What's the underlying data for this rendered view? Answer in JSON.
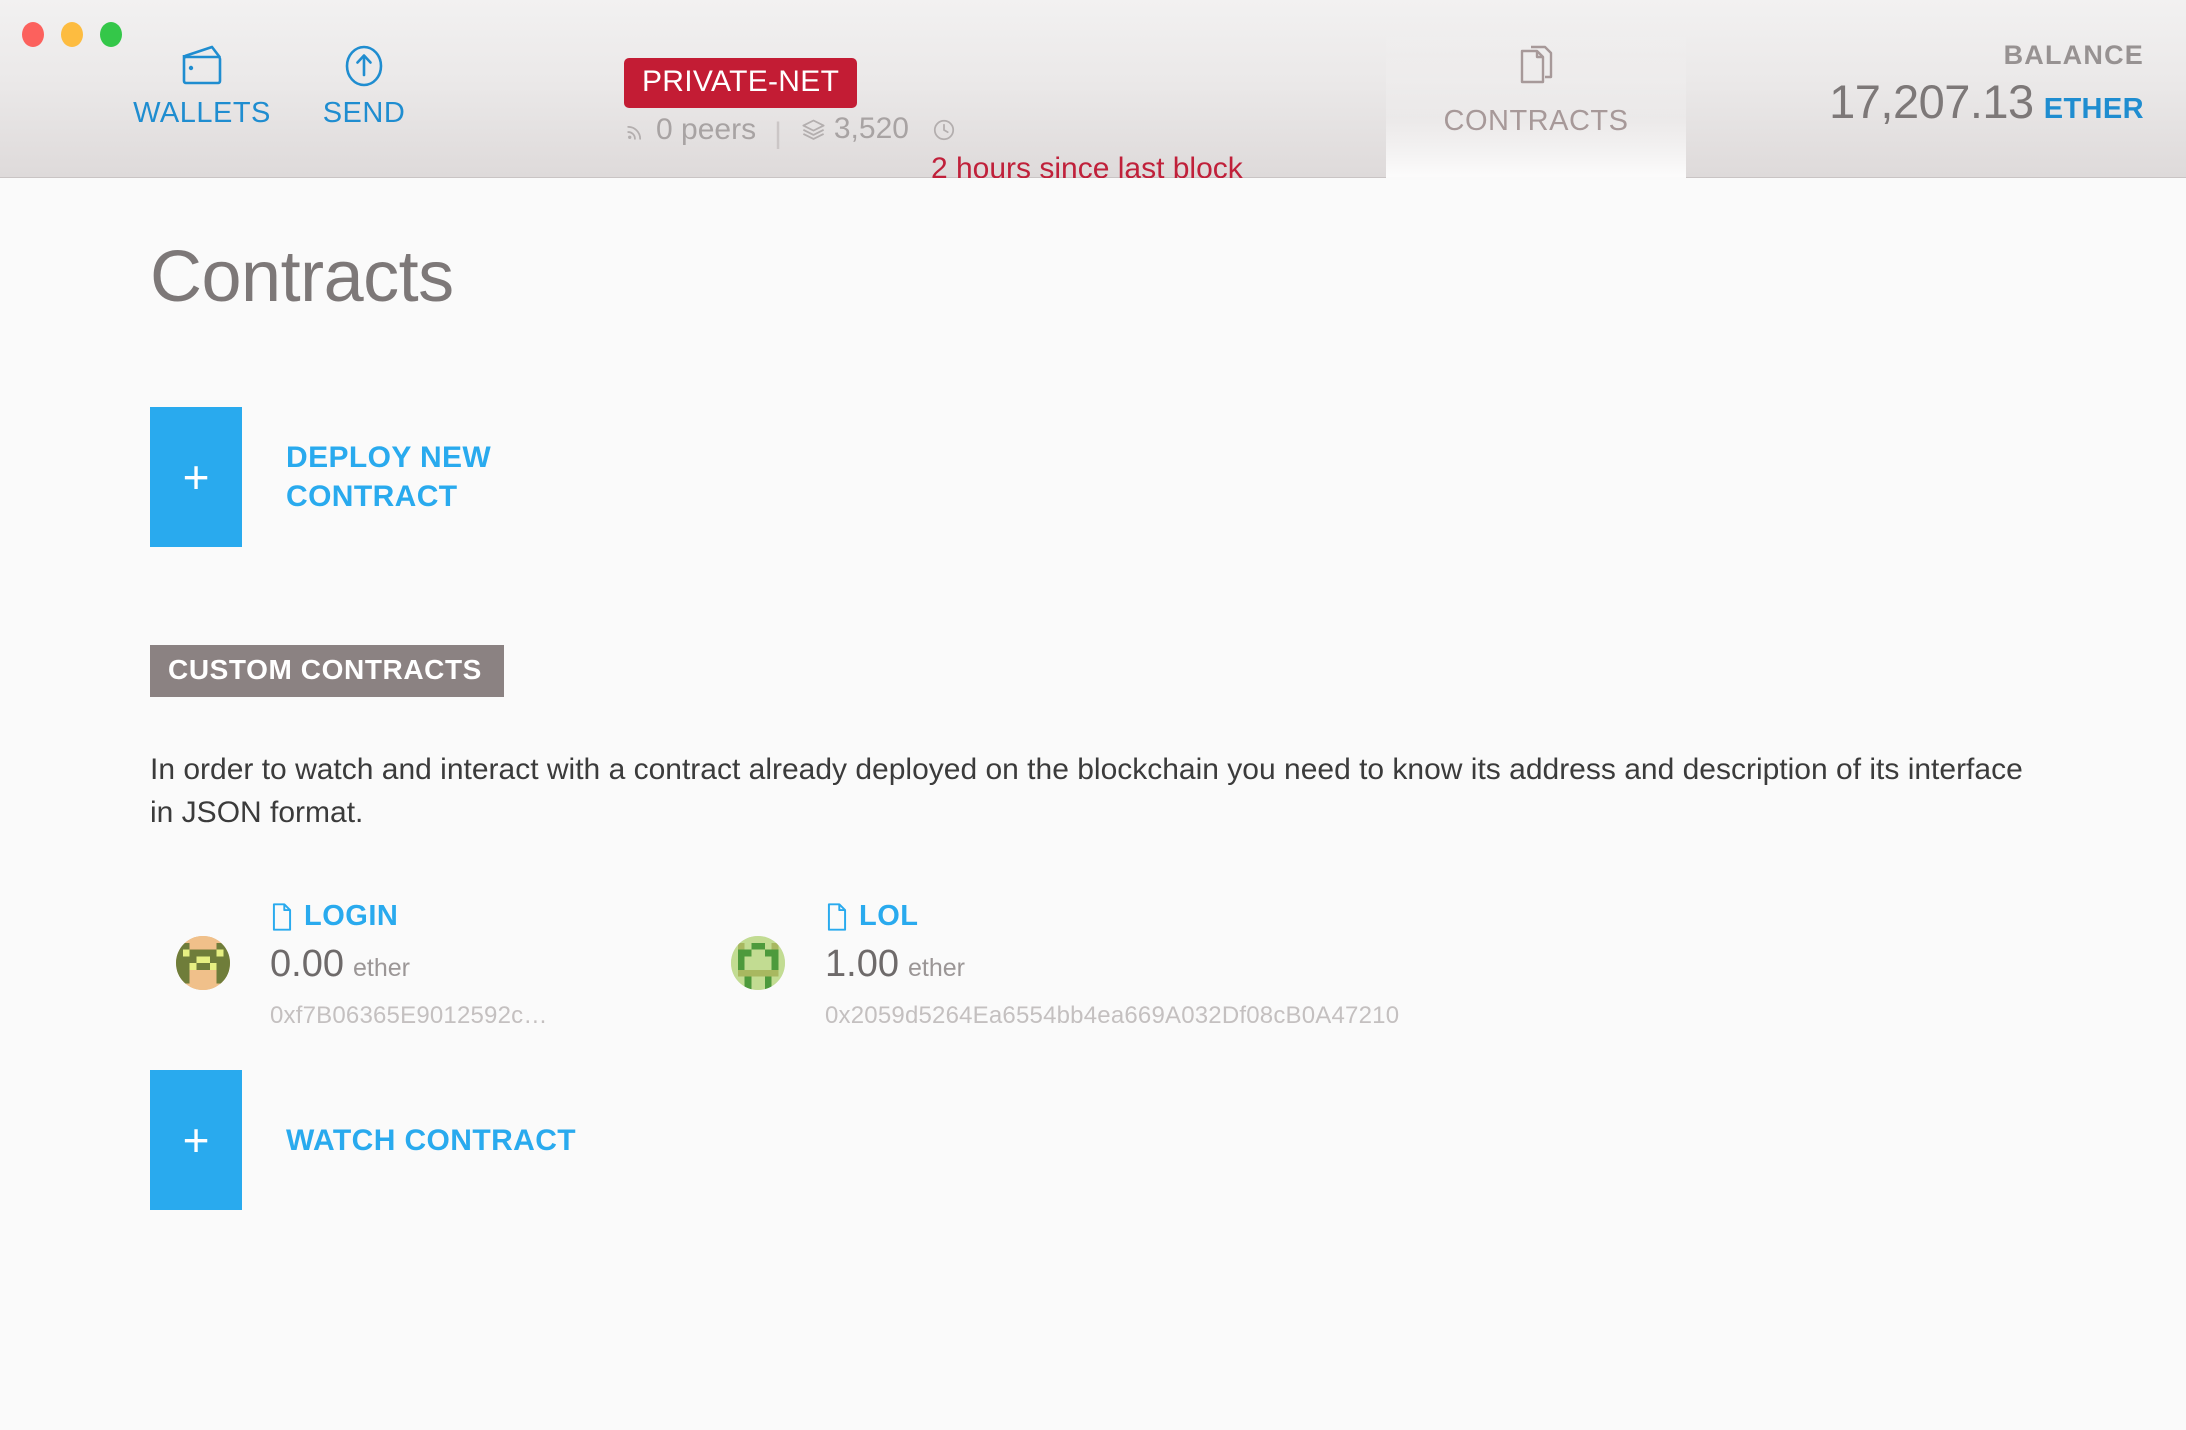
{
  "window": {
    "traffic_lights": [
      "close",
      "minimize",
      "maximize"
    ]
  },
  "header": {
    "nav": [
      {
        "id": "wallets",
        "label": "WALLETS",
        "icon": "wallet-icon",
        "active": false
      },
      {
        "id": "send",
        "label": "SEND",
        "icon": "send-arrow-up-icon",
        "active": false
      },
      {
        "id": "contracts",
        "label": "CONTRACTS",
        "icon": "contracts-documents-icon",
        "active": true
      }
    ],
    "network": {
      "badge_label": "PRIVATE-NET",
      "badge_color": "#c31c34"
    },
    "status": {
      "peers_icon": "signal-icon",
      "peers": "0 peers",
      "divider": "|",
      "blocks_icon": "layers-icon",
      "block_number": "3,520",
      "time_icon": "clock-icon",
      "last_block": "2 hours since last block",
      "last_block_color": "#c0203a"
    },
    "balance": {
      "label": "BALANCE",
      "amount": "17,207.13",
      "unit": "ETHER",
      "unit_color": "#1f8dd0"
    }
  },
  "main": {
    "page_title": "Contracts",
    "deploy": {
      "plus": "+",
      "label": "DEPLOY NEW CONTRACT"
    },
    "section": {
      "chip_label": "CUSTOM CONTRACTS",
      "description": "In order to watch and interact with a contract already deployed on the blockchain you need to know its address and description of its interface in JSON format."
    },
    "contracts": [
      {
        "name": "LOGIN",
        "icon": "document-icon",
        "balance": "0.00",
        "unit": "ether",
        "address": "0xf7B06365E9012592c…",
        "identicon": "olive-green-tan-blockies"
      },
      {
        "name": "LOL",
        "icon": "document-icon",
        "balance": "1.00",
        "unit": "ether",
        "address": "0x2059d5264Ea6554bb4ea669A032Df08cB0A47210",
        "identicon": "light-green-blockies"
      }
    ],
    "watch": {
      "plus": "+",
      "label": "WATCH CONTRACT"
    }
  },
  "theme": {
    "accent_blue": "#29aaee",
    "nav_blue": "#1f8dd0",
    "red": "#c31c34",
    "chip_gray": "#8b8282",
    "page_bg": "#fafafa"
  }
}
